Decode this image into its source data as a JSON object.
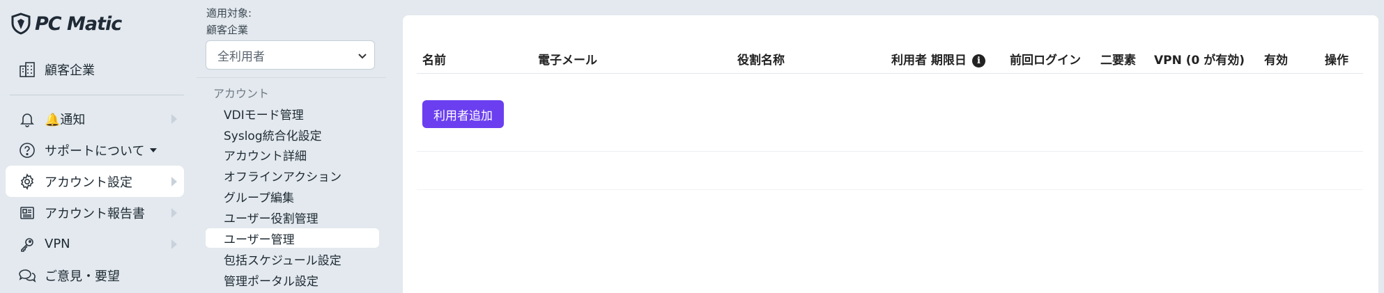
{
  "brand": {
    "name": "PC Matic"
  },
  "sidebar": {
    "items": [
      {
        "label": "顧客企業",
        "icon": "building-icon"
      },
      {
        "label": "🔔通知",
        "icon": "bell-icon"
      },
      {
        "label": "サポートについて",
        "icon": "help-circle-icon"
      },
      {
        "label": "アカウント設定",
        "icon": "gear-icon"
      },
      {
        "label": "アカウント報告書",
        "icon": "newspaper-icon"
      },
      {
        "label": "VPN",
        "icon": "key-icon"
      },
      {
        "label": "ご意見・要望",
        "icon": "chat-icon"
      }
    ]
  },
  "submenu": {
    "target_label": "適用対象:",
    "target_sub": "顧客企業",
    "select_value": "全利用者",
    "section": "アカウント",
    "items": [
      "VDIモード管理",
      "Syslog統合化設定",
      "アカウント詳細",
      "オフラインアクション",
      "グループ編集",
      "ユーザー役割管理",
      "ユーザー管理",
      "包括スケジュール設定",
      "管理ポータル設定"
    ]
  },
  "table": {
    "headers": [
      "名前",
      "電子メール",
      "役割名称",
      "利用者 期限日",
      "前回ログイン",
      "二要素",
      "VPN (0 が有効)",
      "有効",
      "操作"
    ],
    "add_button": "利用者追加"
  },
  "colors": {
    "accent": "#6b3ff0",
    "background": "#e3e9ee",
    "card": "#ffffff"
  }
}
